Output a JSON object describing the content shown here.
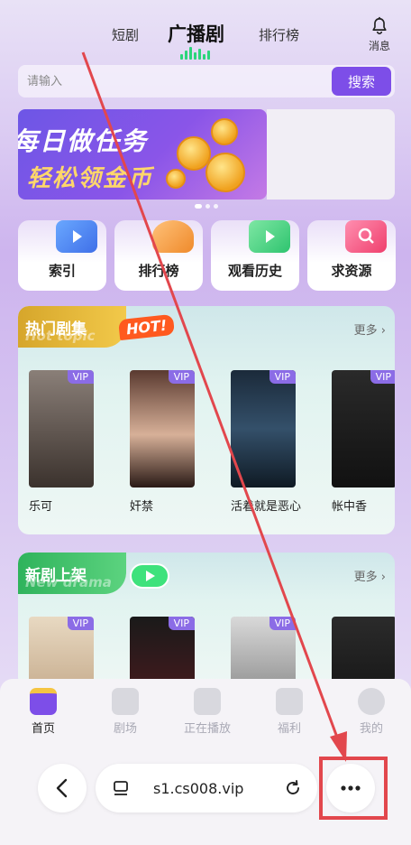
{
  "top_tabs": {
    "left": "短剧",
    "center": "广播剧",
    "right": "排行榜"
  },
  "notification": {
    "label": "消息",
    "icon": "bell-icon"
  },
  "search": {
    "placeholder": "请输入",
    "button": "搜索"
  },
  "banner": {
    "line1": "每日做任务",
    "line2": "轻松领金币"
  },
  "quick_links": [
    {
      "label": "索引",
      "icon": "video-folder-icon",
      "color": "#4f8df7"
    },
    {
      "label": "排行榜",
      "icon": "trophy-icon",
      "color": "#f09a3a"
    },
    {
      "label": "观看历史",
      "icon": "history-folder-icon",
      "color": "#3fcf7e"
    },
    {
      "label": "求资源",
      "icon": "search-folder-icon",
      "color": "#f0527a"
    }
  ],
  "hot_section": {
    "title": "热门剧集",
    "subtitle": "Hot topic",
    "badge": "HOT!",
    "more": "更多",
    "items": [
      {
        "title": "乐可",
        "badge": "VIP"
      },
      {
        "title": "奸禁",
        "badge": "VIP"
      },
      {
        "title": "活着就是恶心",
        "badge": "VIP"
      },
      {
        "title": "帐中香",
        "badge": "VIP"
      }
    ]
  },
  "new_section": {
    "title": "新剧上架",
    "subtitle": "New drama",
    "more": "更多",
    "items": [
      {
        "badge": "VIP"
      },
      {
        "badge": "VIP"
      },
      {
        "badge": "VIP"
      },
      {
        "badge": ""
      }
    ]
  },
  "bottom_nav": [
    {
      "label": "首页",
      "icon": "home-tv-icon",
      "active": true
    },
    {
      "label": "剧场",
      "icon": "theater-tv-icon",
      "active": false
    },
    {
      "label": "正在播放",
      "icon": "camera-icon",
      "active": false
    },
    {
      "label": "福利",
      "icon": "star-gift-icon",
      "active": false
    },
    {
      "label": "我的",
      "icon": "face-icon",
      "active": false
    }
  ],
  "browser": {
    "url": "s1.cs008.vip"
  },
  "colors": {
    "accent": "#7d4ee8",
    "annotation": "#e2474d",
    "hot_green": "#2bd57a"
  }
}
